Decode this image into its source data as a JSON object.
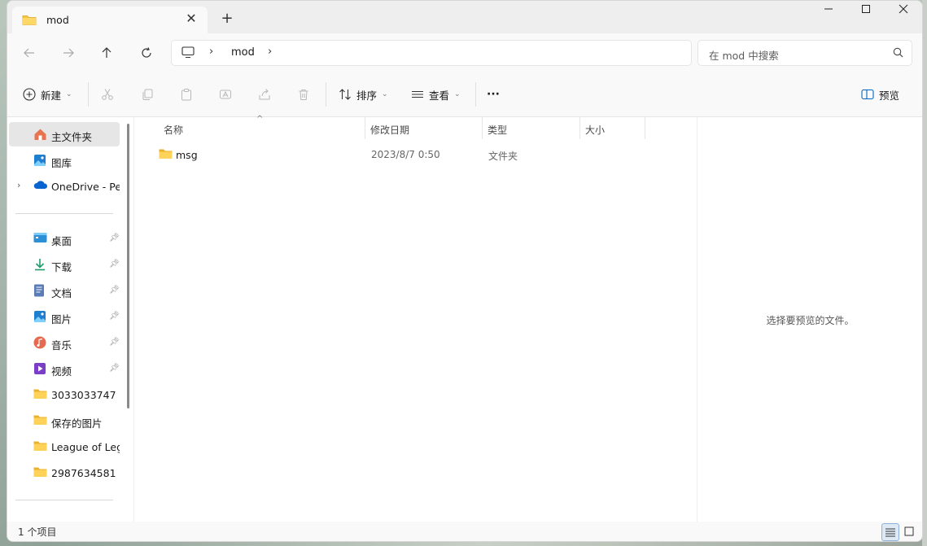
{
  "window": {
    "tab_title": "mod",
    "tab_close": "✕",
    "new_tab": "+",
    "controls": {
      "minimize": "—",
      "maximize": "☐",
      "close": "✕"
    }
  },
  "address": {
    "breadcrumb": [
      "mod"
    ],
    "search_placeholder": "在 mod 中搜索"
  },
  "toolbar": {
    "new_label": "新建",
    "sort_label": "排序",
    "view_label": "查看",
    "more_label": "···",
    "preview_label": "预览"
  },
  "sidebar": {
    "items": [
      {
        "label": "主文件夹",
        "icon": "home-icon",
        "selected": true
      },
      {
        "label": "图库",
        "icon": "gallery-icon"
      },
      {
        "label": "OneDrive - Per",
        "icon": "onedrive-icon",
        "expandable": true
      },
      {
        "label": "桌面",
        "icon": "desktop-icon",
        "pinned": true
      },
      {
        "label": "下载",
        "icon": "download-icon",
        "pinned": true
      },
      {
        "label": "文档",
        "icon": "document-icon",
        "pinned": true
      },
      {
        "label": "图片",
        "icon": "pictures-icon",
        "pinned": true
      },
      {
        "label": "音乐",
        "icon": "music-icon",
        "pinned": true
      },
      {
        "label": "视频",
        "icon": "video-icon",
        "pinned": true
      },
      {
        "label": "3033033747",
        "icon": "folder-icon"
      },
      {
        "label": "保存的图片",
        "icon": "folder-icon"
      },
      {
        "label": "League of Leg",
        "icon": "folder-icon"
      },
      {
        "label": "2987634581",
        "icon": "folder-icon"
      }
    ]
  },
  "table": {
    "columns": [
      "名称",
      "修改日期",
      "类型",
      "大小"
    ],
    "rows": [
      {
        "name": "msg",
        "date": "2023/8/7 0:50",
        "type": "文件夹",
        "size": ""
      }
    ]
  },
  "preview": {
    "empty_text": "选择要预览的文件。"
  },
  "status": {
    "count": "1 个项目"
  },
  "colors": {
    "folder": "#f4c542",
    "accent": "#0067c0",
    "selected": "#e6e6e6"
  }
}
